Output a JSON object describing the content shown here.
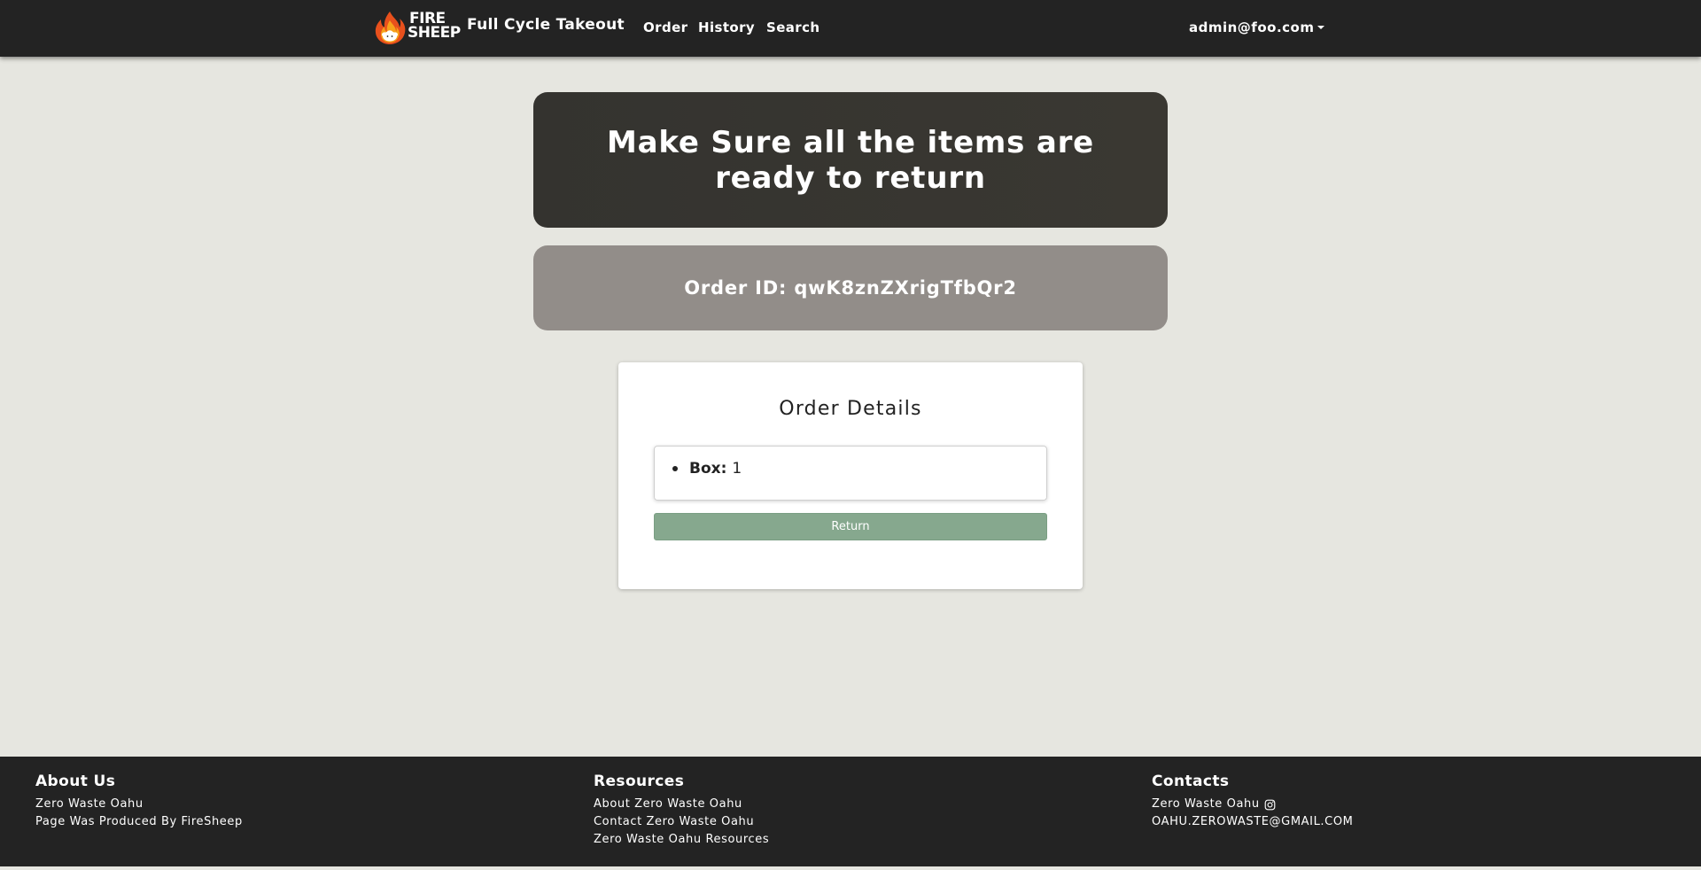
{
  "navbar": {
    "logo_line1": "FIRE",
    "logo_line2": "SHEEP",
    "brand": "Full Cycle Takeout",
    "links": {
      "order": "Order",
      "history": "History",
      "search": "Search"
    },
    "user": "admin@foo.com"
  },
  "banner": {
    "title": "Make Sure all the items are ready to return"
  },
  "order": {
    "id_label": "Order ID: qwK8znZXrigTfbQr2"
  },
  "card": {
    "title": "Order Details",
    "items": [
      {
        "label": "Box:",
        "value": "1"
      }
    ],
    "return_label": "Return"
  },
  "footer": {
    "about": {
      "heading": "About Us",
      "lines": [
        "Zero Waste Oahu",
        "Page Was Produced By FireSheep"
      ]
    },
    "resources": {
      "heading": "Resources",
      "links": [
        "About Zero Waste Oahu",
        "Contact Zero Waste Oahu",
        "Zero Waste Oahu Resources"
      ]
    },
    "contacts": {
      "heading": "Contacts",
      "instagram_label": "Zero Waste Oahu",
      "email": "OAHU.ZEROWASTE@GMAIL.COM"
    }
  },
  "colors": {
    "navbar_bg": "#232323",
    "page_bg": "#e6e6e0",
    "banner_bg": "#373530",
    "order_id_bg": "#928d89",
    "return_button_bg": "#86a88e"
  },
  "icons": {
    "logo": "fire-sheep-logo",
    "dropdown": "caret-down-icon",
    "instagram": "instagram-icon"
  }
}
